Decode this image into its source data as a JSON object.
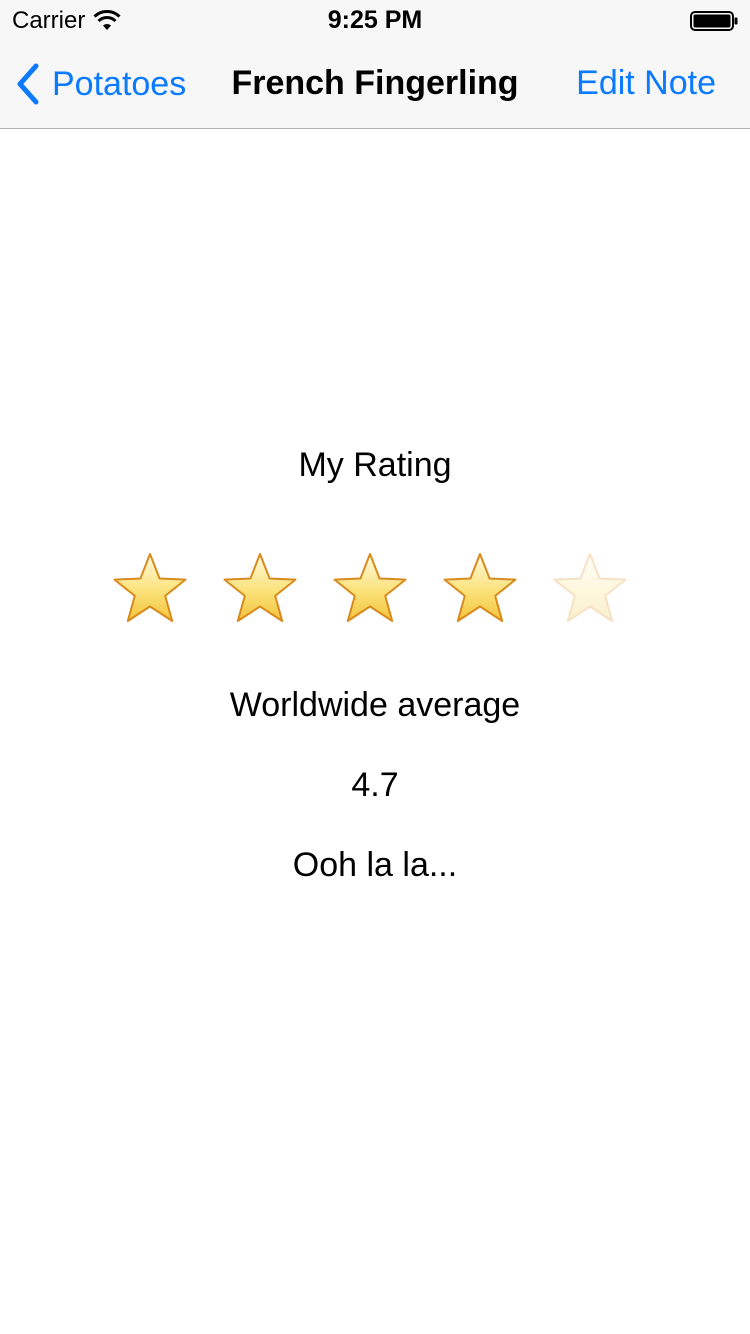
{
  "status_bar": {
    "carrier": "Carrier",
    "time": "9:25 PM",
    "icons": [
      "wifi-icon",
      "battery-icon"
    ]
  },
  "nav": {
    "back_label": "Potatoes",
    "title": "French Fingerling",
    "right_button_label": "Edit Note",
    "accent_color": "#0a7aff"
  },
  "rating": {
    "label": "My Rating",
    "value": 4,
    "max": 5,
    "star_icon": "star-icon"
  },
  "average": {
    "label": "Worldwide average",
    "value": "4.7"
  },
  "note": "Ooh la la..."
}
